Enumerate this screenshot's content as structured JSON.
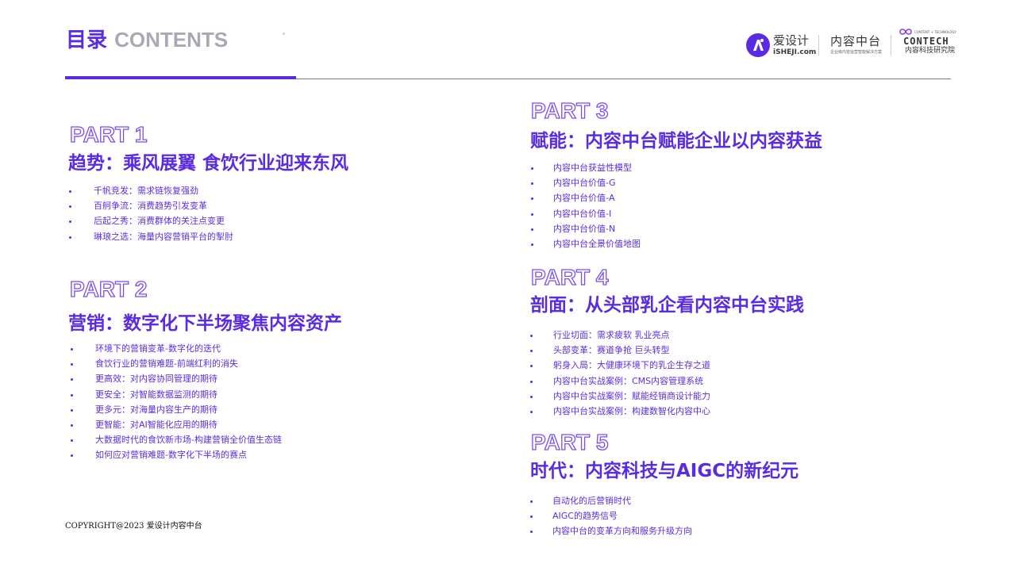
{
  "header": {
    "title_cn": "目录",
    "title_en": "CONTENTS"
  },
  "logos": {
    "aisheji": {
      "name": "爱设计",
      "domain": "iSHEJI.com"
    },
    "neirong": {
      "name": "内容中台",
      "slogan": "企业级内容运营智能解决方案"
    },
    "contech": {
      "top": "CONTENT + TECHNOLOGY",
      "name": "CONTECH",
      "sub": "内容科技研究院"
    }
  },
  "parts": [
    {
      "label": "PART 1",
      "heading": "趋势：乘风展翼 食饮行业迎来东风",
      "items": [
        "千帆竞发：需求链恢复强劲",
        "百舸争流：消费趋势引发变革",
        "后起之秀：消费群体的关注点变更",
        "琳琅之选：海量内容营销平台的掣肘"
      ]
    },
    {
      "label": "PART 2",
      "heading": "营销：数字化下半场聚焦内容资产",
      "items": [
        "环境下的营销变革-数字化的迭代",
        "食饮行业的营销难题-前端红利的消失",
        "更高效：对内容协同管理的期待",
        "更安全：对智能数据监测的期待",
        "更多元：对海量内容生产的期待",
        "更智能：对AI智能化应用的期待",
        "大数据时代的食饮新市场-构建营销全价值生态链",
        "如何应对营销难题-数字化下半场的赛点"
      ]
    },
    {
      "label": "PART 3",
      "heading": "赋能：内容中台赋能企业以内容获益",
      "items": [
        "内容中台获益性模型",
        "内容中台价值-G",
        "内容中台价值-A",
        "内容中台价值-I",
        "内容中台价值-N",
        "内容中台全景价值地图"
      ]
    },
    {
      "label": "PART 4",
      "heading": "剖面：从头部乳企看内容中台实践",
      "items": [
        "行业切面：需求疲软 乳业亮点",
        "头部变革：赛道争抢 巨头转型",
        "躬身入局：大健康环境下的乳企生存之道",
        "内容中台实战案例：CMS内容管理系统",
        "内容中台实战案例：赋能经销商设计能力",
        "内容中台实战案例：构建数智化内容中心"
      ]
    },
    {
      "label": "PART 5",
      "heading": "时代：内容科技与AIGC的新纪元",
      "items": [
        "自动化的后营销时代",
        "AIGC的趋势信号",
        "内容中台的变革方向和服务升级方向"
      ]
    }
  ],
  "footer": {
    "copyright": "COPYRIGHT@2023 爱设计内容中台"
  },
  "colors": {
    "accent": "#5b2be3",
    "muted_title": "#a9a9b3",
    "rule": "#7a7a7a"
  }
}
